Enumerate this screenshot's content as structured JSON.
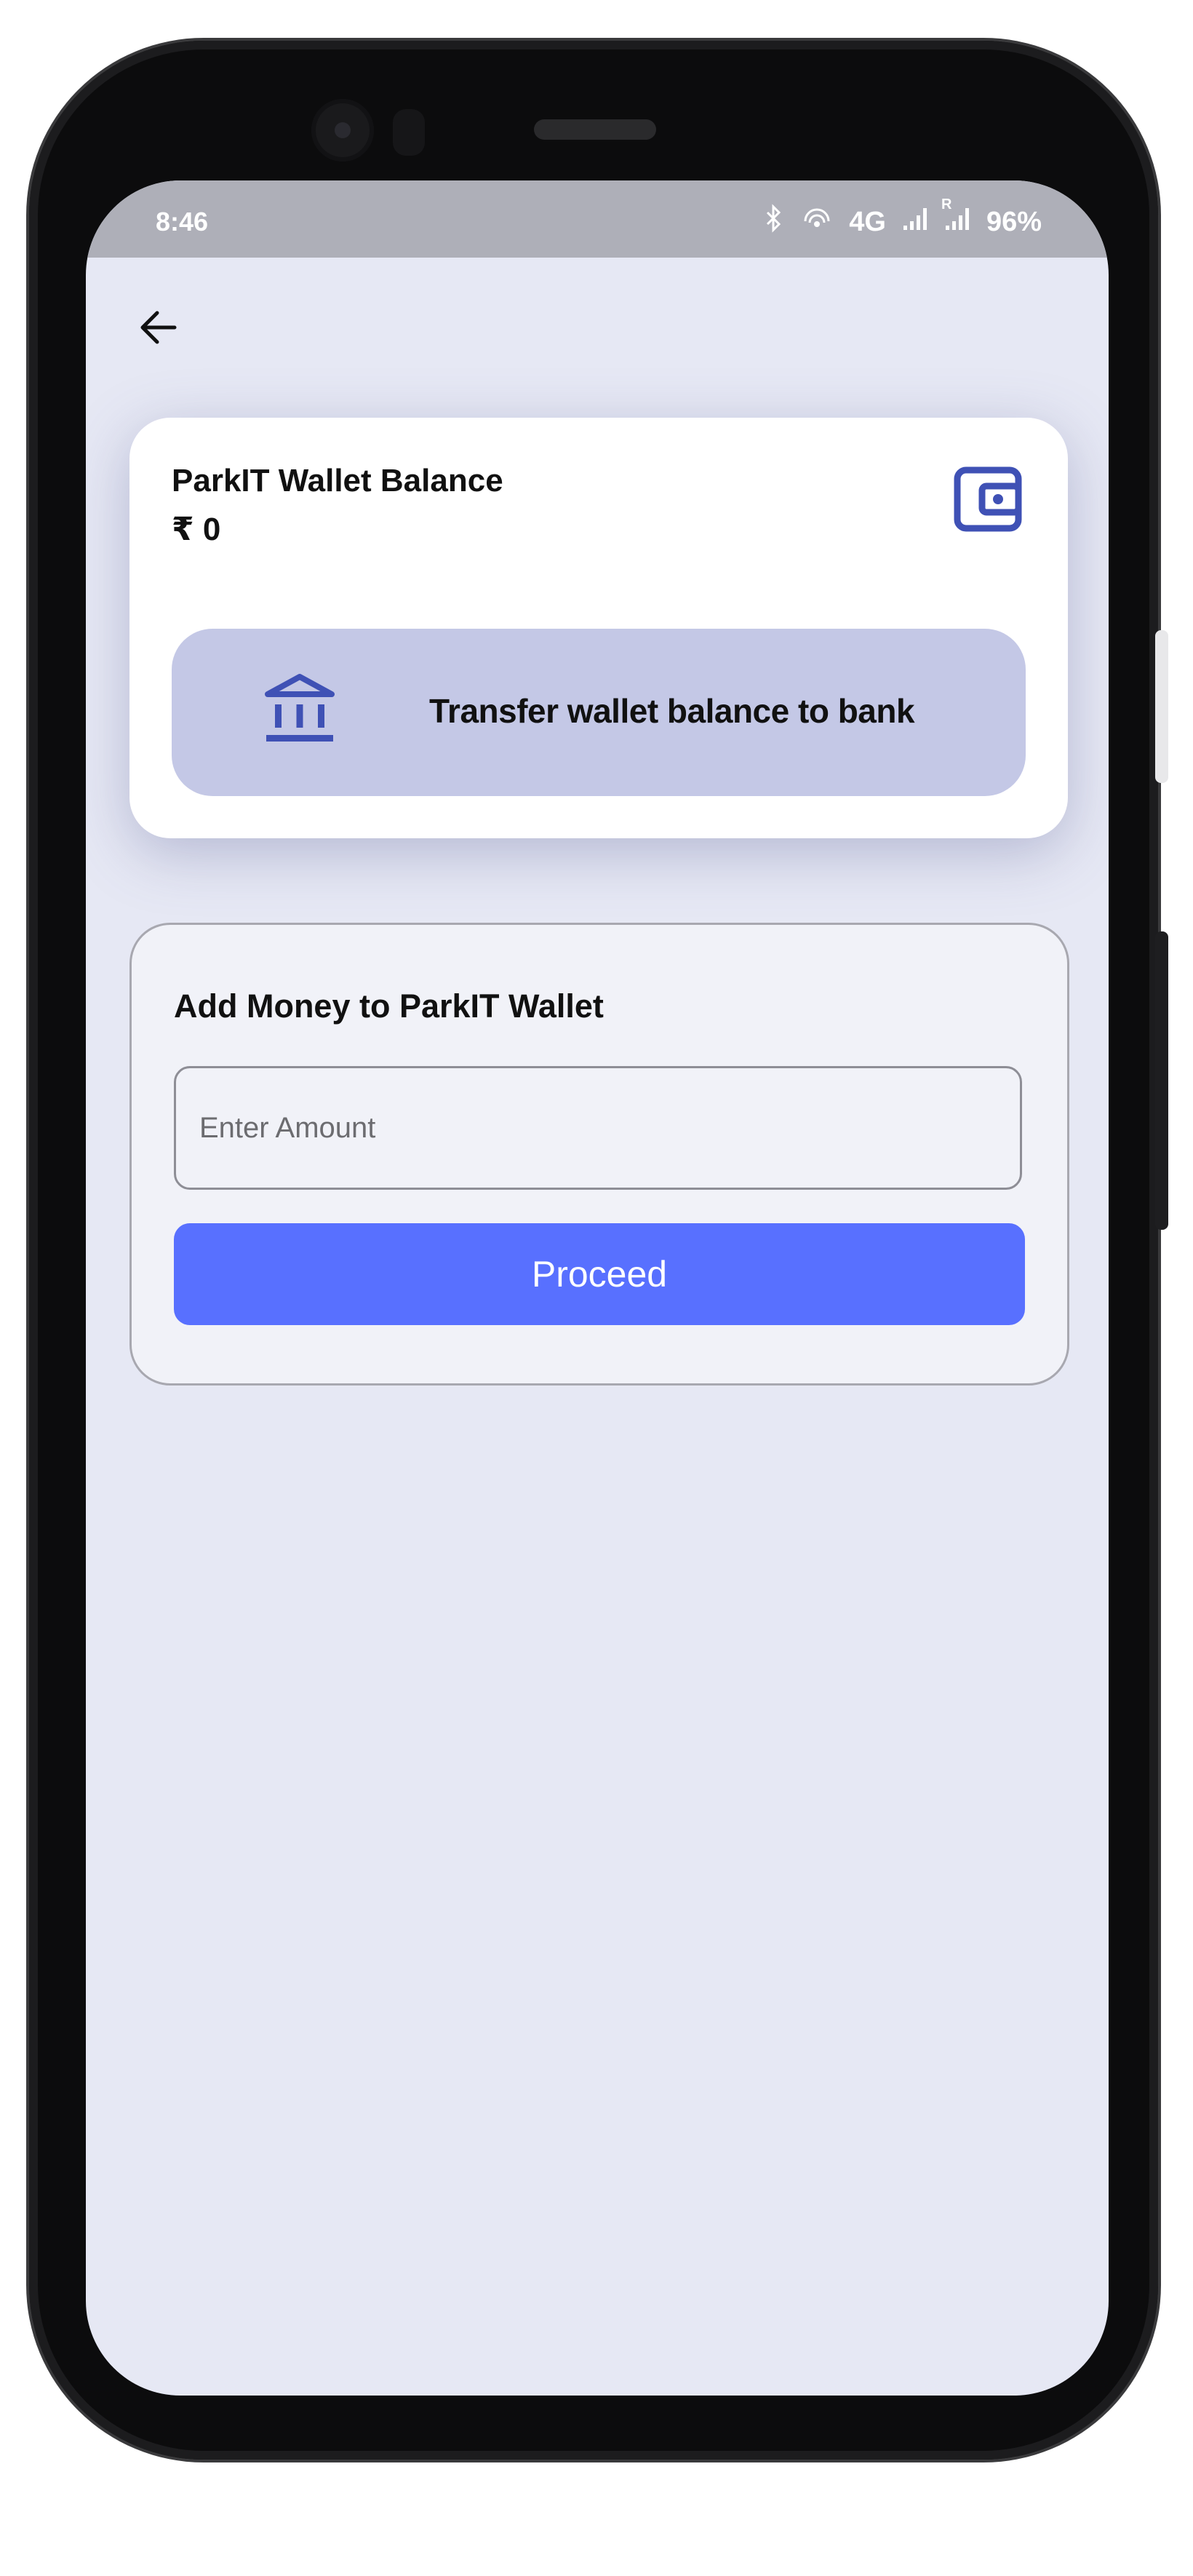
{
  "status_bar": {
    "time": "8:46",
    "network": "4G",
    "roaming": "R",
    "battery": "96%"
  },
  "header": {
    "back_icon": "arrow-left-icon"
  },
  "wallet": {
    "title": "ParkIT Wallet Balance",
    "balance": "₹ 0",
    "icon": "wallet-icon",
    "transfer_label": "Transfer wallet balance to bank",
    "transfer_icon": "bank-icon"
  },
  "add_money": {
    "title": "Add Money to ParkIT Wallet",
    "amount_placeholder": "Enter Amount",
    "amount_value": "",
    "proceed_label": "Proceed"
  },
  "colors": {
    "accent_blue": "#5870ff",
    "icon_indigo": "#3f51b5",
    "screen_bg": "#e6e8f4",
    "transfer_bg": "#c4c8e6"
  }
}
